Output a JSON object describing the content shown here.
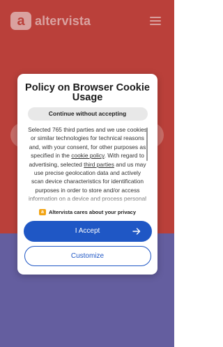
{
  "header": {
    "logo_text": "altervista",
    "logo_mark": "a",
    "menu_icon": "hamburger-menu-icon"
  },
  "colors": {
    "background_red": "#c5443e",
    "background_purple": "#6a64a8",
    "accent_blue": "#1f57c5",
    "brand_orange": "#f2a413"
  },
  "consent": {
    "title": "Policy on Browser Cookie Usage",
    "continue_label": "Continue without accepting",
    "body_part1": "Selected 765 third parties and we use cookies or similar technologies for technical reasons and, with your consent, for other purposes as specified in the ",
    "cookie_policy_link": "cookie policy",
    "body_part2": ". With regard to advertising, selected ",
    "third_parties_link": "third parties",
    "body_part3": " and us may use precise geolocation data and actively scan device characteristics for identification purposes in order to store and/or access information on a device and process personal",
    "cares_text": "Altervista cares about your privacy",
    "cares_logo": "a",
    "accept_label": "I Accept",
    "customize_label": "Customize"
  }
}
